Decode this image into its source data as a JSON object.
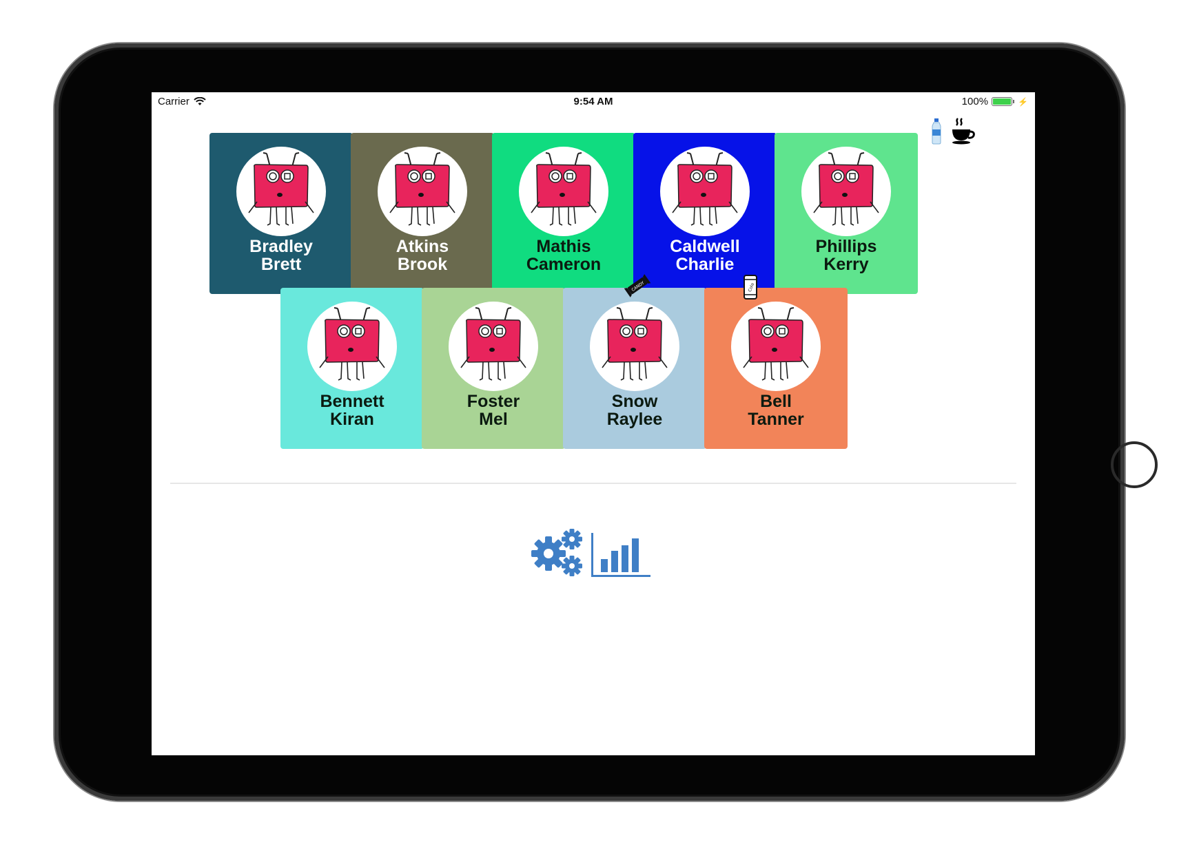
{
  "status_bar": {
    "carrier": "Carrier",
    "time": "9:54 AM",
    "battery": "100%",
    "battery_level": 1.0
  },
  "colors": {
    "accent": "#3f7fc6",
    "avatar_body": "#e8245c"
  },
  "top_icons": [
    "water-bottle-icon",
    "coffee-cup-icon"
  ],
  "students": [
    {
      "last": "Bradley",
      "first": "Brett",
      "color": "#1e5a6e",
      "text_color": "#ffffff"
    },
    {
      "last": "Atkins",
      "first": "Brook",
      "color": "#6a6a4e",
      "text_color": "#ffffff"
    },
    {
      "last": "Mathis",
      "first": "Cameron",
      "color": "#10dc80",
      "text_color": "#0b1a10"
    },
    {
      "last": "Caldwell",
      "first": "Charlie",
      "color": "#0612e8",
      "text_color": "#ffffff"
    },
    {
      "last": "Phillips",
      "first": "Kerry",
      "color": "#5fe48e",
      "text_color": "#0b1a10"
    },
    {
      "last": "Bennett",
      "first": "Kiran",
      "color": "#69e8dc",
      "text_color": "#0b1a10"
    },
    {
      "last": "Foster",
      "first": "Mel",
      "color": "#a9d495",
      "text_color": "#0b1a10"
    },
    {
      "last": "Snow",
      "first": "Raylee",
      "color": "#aacbde",
      "text_color": "#0b1a10",
      "item": "candy-icon",
      "item_label": "CANDY"
    },
    {
      "last": "Bell",
      "first": "Tanner",
      "color": "#f28459",
      "text_color": "#0b1a10",
      "item": "cola-can-icon",
      "item_label": "Cola"
    }
  ],
  "bottom_toolbar": [
    "settings-gears-icon",
    "bar-chart-icon"
  ]
}
